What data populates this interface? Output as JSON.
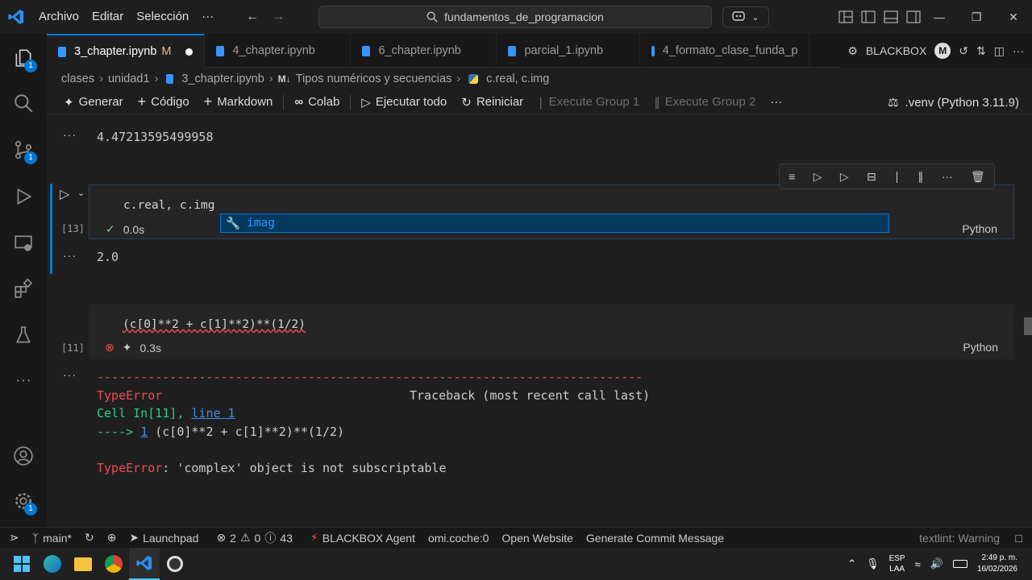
{
  "menu": {
    "file": "Archivo",
    "edit": "Editar",
    "selection": "Selección",
    "more": "···"
  },
  "search": {
    "text": "fundamentos_de_programacion"
  },
  "tabs": [
    {
      "label": "3_chapter.ipynb",
      "modified": "M"
    },
    {
      "label": "4_chapter.ipynb"
    },
    {
      "label": "6_chapter.ipynb"
    },
    {
      "label": "parcial_1.ipynb"
    },
    {
      "label": "4_formato_clase_funda_p"
    }
  ],
  "tab_actions": {
    "blackbox": "BLACKBOX",
    "more": "···"
  },
  "breadcrumb": {
    "p1": "clases",
    "p2": "unidad1",
    "p3": "3_chapter.ipynb",
    "p4": "Tipos numéricos y secuencias",
    "p5": "c.real, c.img"
  },
  "toolbar": {
    "generate": "Generar",
    "code": "Código",
    "markdown": "Markdown",
    "colab": "Colab",
    "run_all": "Ejecutar todo",
    "restart": "Reiniciar",
    "group1": "Execute Group 1",
    "group2": "Execute Group 2",
    "more": "···",
    "kernel": ".venv (Python 3.11.9)"
  },
  "badges": {
    "explorer": "1",
    "source_control": "1",
    "settings": "1"
  },
  "notebook": {
    "prev_output": "4.47213595499958",
    "cell13": {
      "code_a": "c.real,",
      "code_b": " c.img",
      "count": "[13]",
      "time": "0.0s",
      "lang": "Python",
      "suggestion": "imag",
      "output": "2.0"
    },
    "cell11": {
      "code": "(c[0]**2 + c[1]**2)**(1/2)",
      "count": "[11]",
      "time": "0.3s",
      "lang": "Python"
    },
    "traceback": {
      "dashes": "---------------------------------------------------------------------------",
      "error_name": "TypeError",
      "traceback_label": "Traceback (most recent call last)",
      "cell_prefix": "Cell In[11], ",
      "line_link": "line 1",
      "arrow": "----> ",
      "arrow_num": "1",
      "arrow_code": " (c[0]**2 + c[1]**2)**(1/2)",
      "final_name": "TypeError",
      "final_msg": ": 'complex' object is not subscriptable"
    }
  },
  "statusbar": {
    "branch": "main*",
    "launchpad": "Launchpad",
    "errors": "2",
    "warnings": "0",
    "info": "43",
    "agent": "BLACKBOX Agent",
    "coche": "omi.coche:0",
    "website": "Open Website",
    "commit": "Generate Commit Message",
    "textlint": "textlint: Warning"
  },
  "tray": {
    "lang1": "ESP",
    "lang2": "LAA",
    "time": "2:49 p. m.",
    "date": "16/02/2026"
  }
}
